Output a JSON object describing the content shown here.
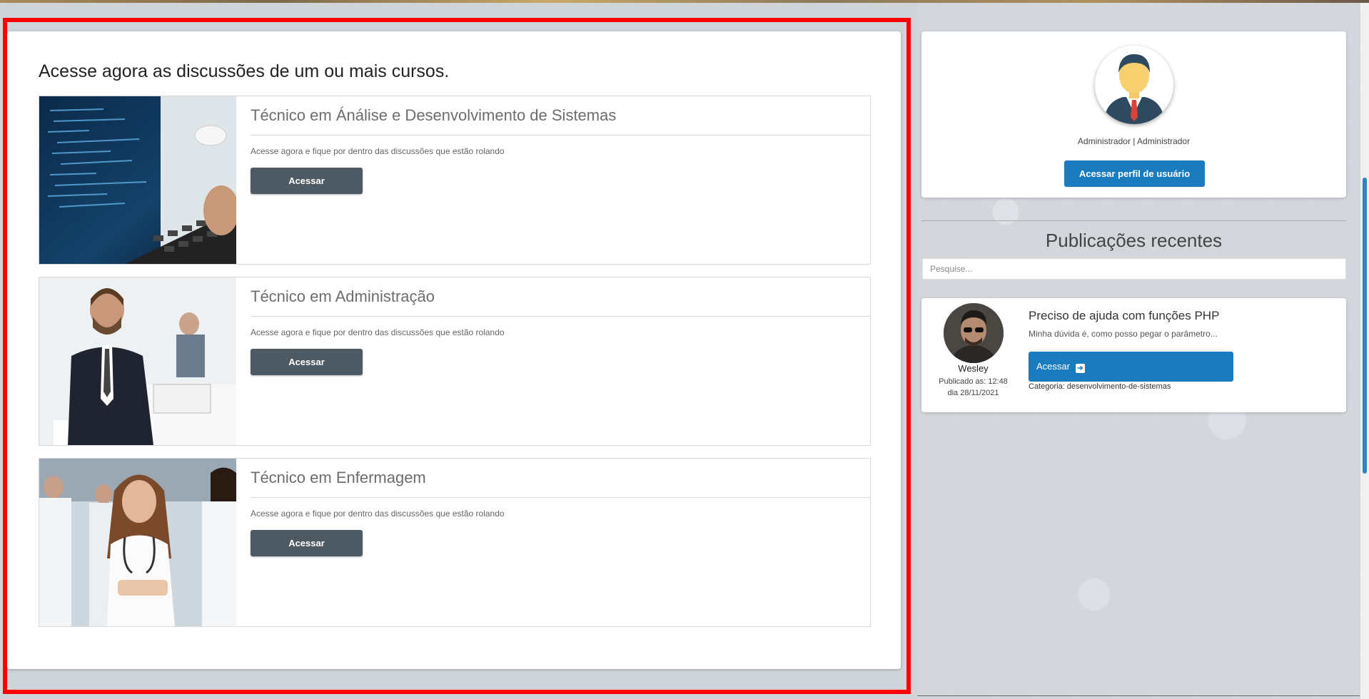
{
  "main": {
    "title": "Acesse agora as discussões de um ou mais cursos.",
    "courses": [
      {
        "title": "Técnico em Ánálise e Desenvolvimento de Sistemas",
        "description": "Acesse agora e fique por dentro das discussões que estão rolando",
        "button_label": "Acessar"
      },
      {
        "title": "Técnico em Administração",
        "description": "Acesse agora e fique por dentro das discussões que estão rolando",
        "button_label": "Acessar"
      },
      {
        "title": "Técnico em Enfermagem",
        "description": "Acesse agora e fique por dentro das discussões que estão rolando",
        "button_label": "Acessar"
      }
    ]
  },
  "profile": {
    "label": "Administrador | Administrador",
    "button_label": "Acessar perfil de usuário"
  },
  "recent": {
    "title": "Publicações recentes",
    "search_placeholder": "Pesquise...",
    "posts": [
      {
        "author": "Wesley",
        "published_time": "Publicado as: 12:48",
        "published_date": "dia 28/11/2021",
        "title": "Preciso de ajuda com funções PHP",
        "excerpt": "Minha dúvida é, como posso pegar o parâmetro...",
        "button_label": "Acessar",
        "category": "Categoria: desenvolvimento-de-sistemas"
      }
    ]
  },
  "colors": {
    "highlight_frame": "#ff0000",
    "dark_button": "#4e5a63",
    "primary_button": "#1a7bbf"
  },
  "icons": {
    "post_button_icon": "arrow-right-icon"
  }
}
